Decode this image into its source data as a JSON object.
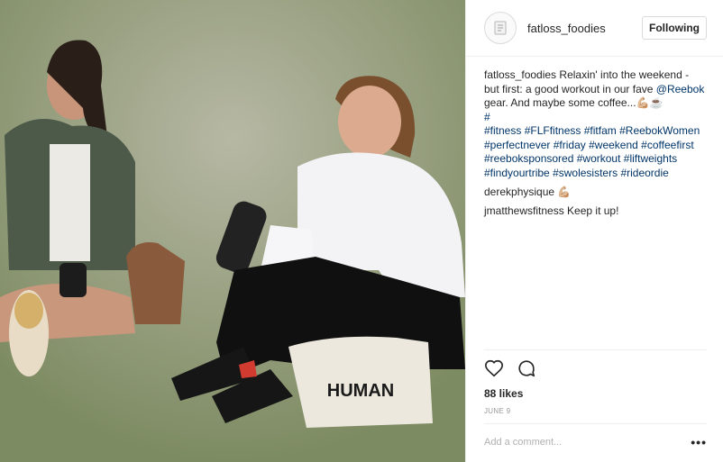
{
  "post": {
    "username": "fatloss_foodies",
    "follow_label": "Following",
    "caption_username": "fatloss_foodies",
    "caption_text_1": "Relaxin' into the weekend - but first: a good workout in our fave",
    "caption_mention": "@Reebok",
    "caption_text_2": "gear. And maybe some coffee...💪🏼☕️",
    "caption_hash": "#",
    "hashtags": [
      "#fitness",
      "#FLFfitness",
      "#fitfam",
      "#ReebokWomen",
      "#perfectnever",
      "#friday",
      "#weekend",
      "#coffeefirst",
      "#reeboksponsored",
      "#workout",
      "#liftweights",
      "#findyourtribe",
      "#swolesisters",
      "#rideordie"
    ],
    "comments": [
      {
        "username": "derekphysique",
        "text": "💪🏼"
      },
      {
        "username": "jmatthewsfitness",
        "text": "Keep it up!"
      }
    ],
    "likes": "88 likes",
    "date": "JUNE 9",
    "comment_placeholder": "Add a comment...",
    "more_label": "•••",
    "icons": [
      "heart-icon",
      "comment-icon",
      "avatar-icon"
    ],
    "photo_tote_text": "HUMAN"
  }
}
